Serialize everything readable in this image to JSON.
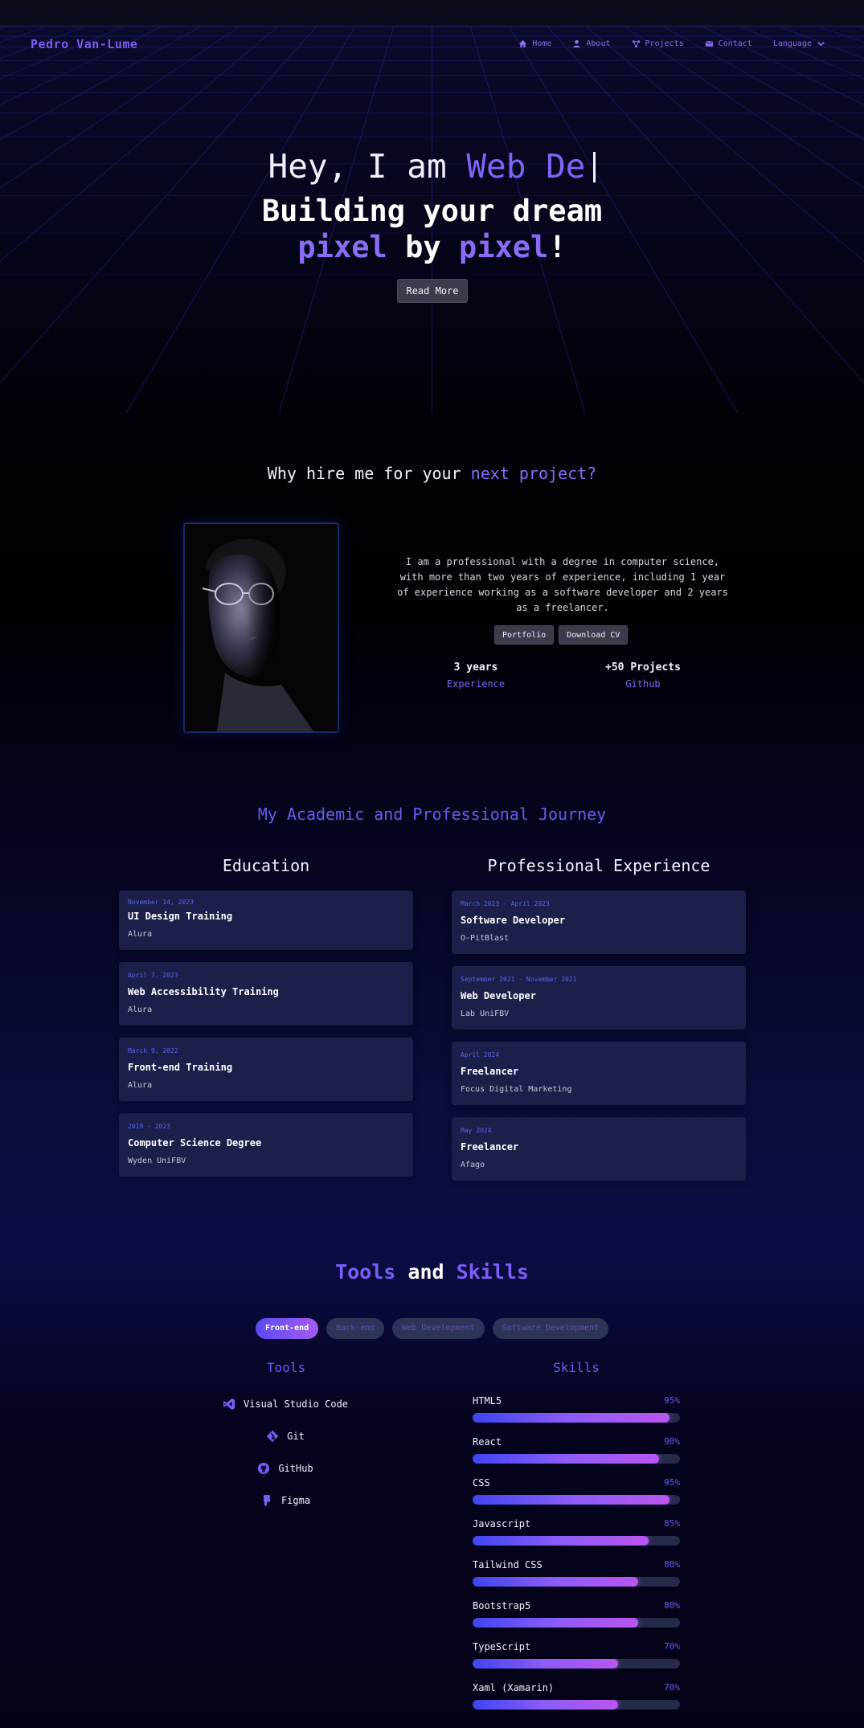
{
  "nav": {
    "brand": "Pedro Van-Lume",
    "links": [
      "Home",
      "About",
      "Projects",
      "Contact",
      "Language"
    ]
  },
  "hero": {
    "hello": "Hey, I am",
    "typed": "Web De",
    "line1": "Building your dream",
    "pixel": "pixel",
    "by": "by",
    "exclaim": "!",
    "button": "Read More"
  },
  "about": {
    "title_plain": "Why hire me for your",
    "title_accent": "next project?",
    "text": "I am a professional with a degree in computer science, with more than two years of experience, including 1 year of experience working as a software developer and 2 years as a freelancer.",
    "buttons": [
      "Portfolio",
      "Download CV"
    ],
    "stats": [
      {
        "value": "3 years",
        "label": "Experience"
      },
      {
        "value": "+50 Projects",
        "label": "Github"
      }
    ]
  },
  "journey": {
    "title": "My Academic and Professional Journey",
    "education_title": "Education",
    "experience_title": "Professional Experience",
    "education": [
      {
        "date": "November 14, 2023",
        "title": "UI Design Training",
        "org": "Alura"
      },
      {
        "date": "April 7, 2023",
        "title": "Web Accessibility Training",
        "org": "Alura"
      },
      {
        "date": "March 9, 2022",
        "title": "Front-end Training",
        "org": "Alura"
      },
      {
        "date": "2019 - 2023",
        "title": "Computer Science Degree",
        "org": "Wyden UniFBV"
      }
    ],
    "experience": [
      {
        "date": "March 2023 - April 2023",
        "title": "Software Developer",
        "org": "O-PitBlast"
      },
      {
        "date": "September 2021 - November 2021",
        "title": "Web Developer",
        "org": "Lab UniFBV"
      },
      {
        "date": "April 2024",
        "title": "Freelancer",
        "org": "Focus Digital Marketing"
      },
      {
        "date": "May 2024",
        "title": "Freelancer",
        "org": "Afago"
      }
    ]
  },
  "skills_section": {
    "title_a": "Tools",
    "title_and": "and",
    "title_b": "Skills",
    "tabs": [
      "Front-end",
      "Back-end",
      "Web Development",
      "Software Development"
    ],
    "active_tab": "Front-end",
    "tools_title": "Tools",
    "skills_title": "Skills",
    "tools": [
      {
        "name": "Visual Studio Code",
        "icon": "vscode-icon"
      },
      {
        "name": "Git",
        "icon": "git-icon"
      },
      {
        "name": "GitHub",
        "icon": "github-icon"
      },
      {
        "name": "Figma",
        "icon": "figma-icon"
      }
    ],
    "skills": [
      {
        "name": "HTML5",
        "percent": 95,
        "label": "95%"
      },
      {
        "name": "React",
        "percent": 90,
        "label": "90%"
      },
      {
        "name": "CSS",
        "percent": 95,
        "label": "95%"
      },
      {
        "name": "Javascript",
        "percent": 85,
        "label": "85%"
      },
      {
        "name": "Tailwind CSS",
        "percent": 80,
        "label": "80%"
      },
      {
        "name": "Bootstrap5",
        "percent": 80,
        "label": "80%"
      },
      {
        "name": "TypeScript",
        "percent": 70,
        "label": "70%"
      },
      {
        "name": "Xaml (Xamarin)",
        "percent": 70,
        "label": "70%"
      }
    ]
  },
  "colors": {
    "accent": "#7b5cf0",
    "card": "#1c1f4a",
    "button": "#3a3c4c"
  }
}
